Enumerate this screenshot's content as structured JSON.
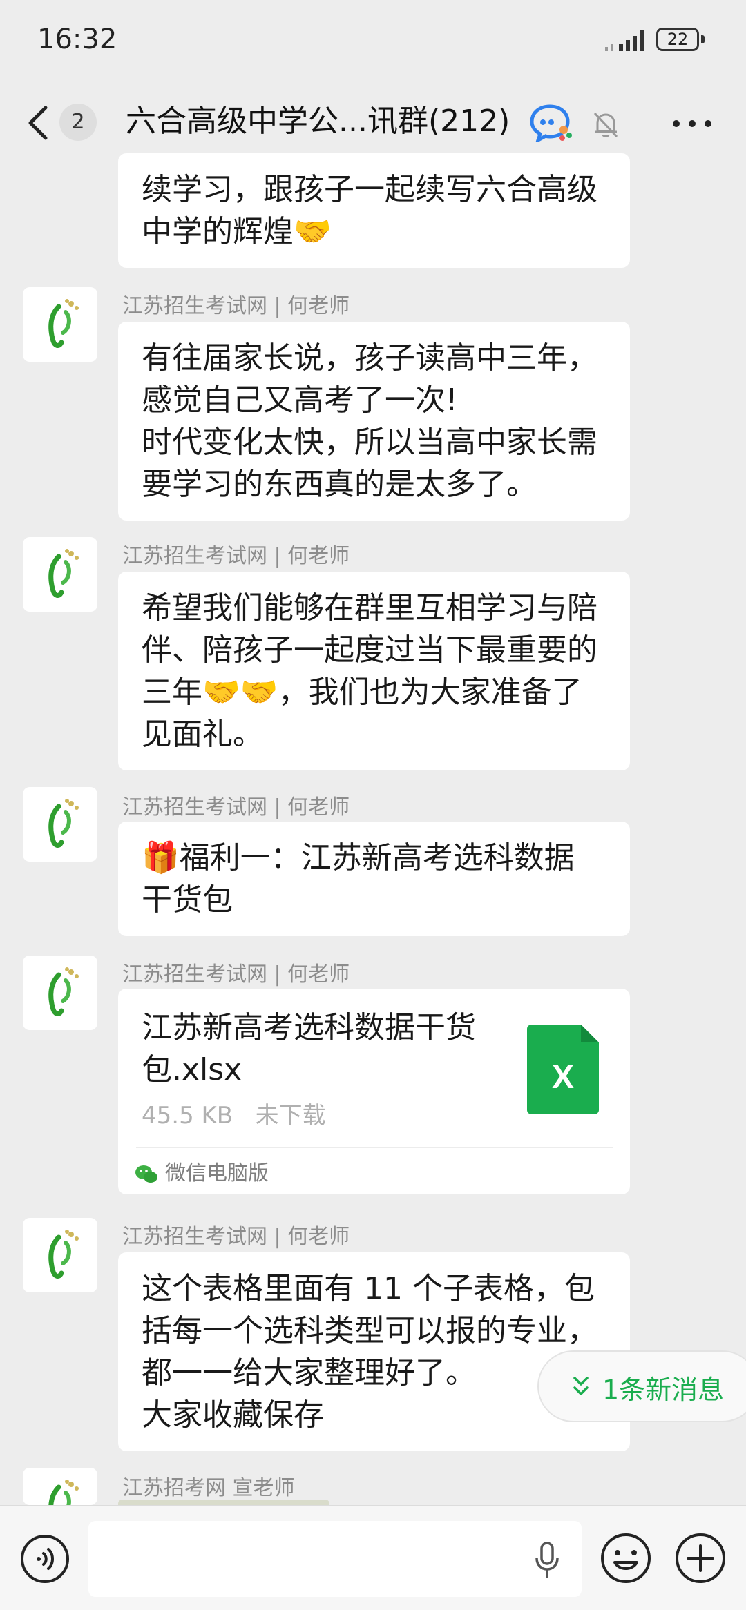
{
  "status": {
    "time": "16:32",
    "battery": "22"
  },
  "nav": {
    "unread": "2",
    "title": "六合高级中学公...讯群(212)"
  },
  "messages": [
    {
      "text": "续学习，跟孩子一起续写六合高级\n中学的辉煌🤝"
    },
    {
      "sender": "江苏招生考试网 | 何老师",
      "text": "有往届家长说，孩子读高中三年，\n感觉自己又高考了一次!\n时代变化太快，所以当高中家长需\n要学习的东西真的是太多了。"
    },
    {
      "sender": "江苏招生考试网 | 何老师",
      "text": "希望我们能够在群里互相学习与陪\n伴、陪孩子一起度过当下最重要的\n三年🤝🤝，我们也为大家准备了\n见面礼。"
    },
    {
      "sender": "江苏招生考试网 | 何老师",
      "text": "🎁福利一：江苏新高考选科数据\n干货包"
    },
    {
      "sender": "江苏招生考试网 | 何老师"
    },
    {
      "sender": "江苏招生考试网 | 何老师",
      "text": "这个表格里面有 11 个子表格，包\n括每一个选科类型可以报的专业，\n都一一给大家整理好了。\n大家收藏保存"
    },
    {
      "sender": "江苏招考网 宣老师"
    }
  ],
  "file": {
    "name": "江苏新高考选科数据干货包.xlsx",
    "size": "45.5 KB",
    "status": "未下载",
    "source": "微信电脑版",
    "icon": "excel-file-icon",
    "icon_color": "#1aad4e"
  },
  "new_message_pill": "1条新消息",
  "colors": {
    "accent_green": "#1aad4e",
    "background": "#ededed",
    "bubble": "#ffffff"
  }
}
